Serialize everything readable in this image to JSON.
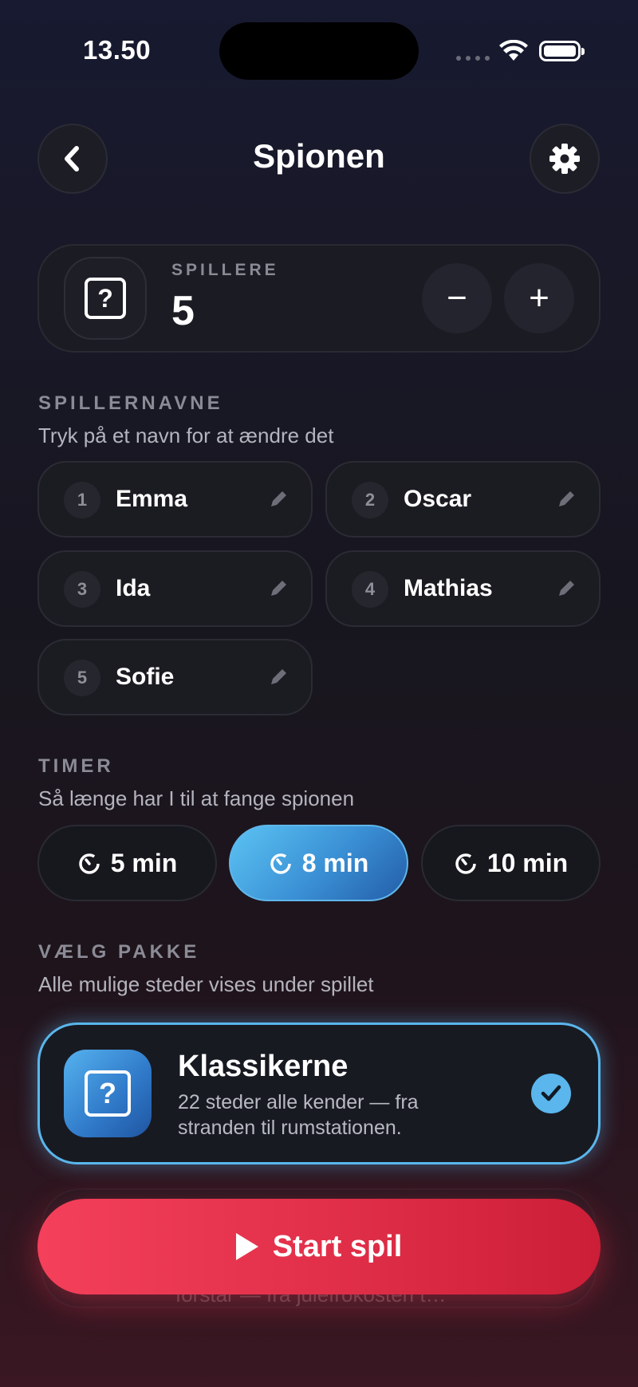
{
  "status_bar": {
    "time": "13.50"
  },
  "header": {
    "title": "Spionen"
  },
  "players": {
    "label": "SPILLERE",
    "count": "5",
    "minus": "−",
    "plus": "+"
  },
  "names_section": {
    "label": "SPILLERNAVNE",
    "subtitle": "Tryk på et navn for at ændre det",
    "players": [
      {
        "num": "1",
        "name": "Emma"
      },
      {
        "num": "2",
        "name": "Oscar"
      },
      {
        "num": "3",
        "name": "Ida"
      },
      {
        "num": "4",
        "name": "Mathias"
      },
      {
        "num": "5",
        "name": "Sofie"
      }
    ]
  },
  "timer_section": {
    "label": "TIMER",
    "subtitle": "Så længe har I til at fange spionen",
    "options": [
      "5 min",
      "8 min",
      "10 min"
    ],
    "selected": "8 min"
  },
  "pack_section": {
    "label": "VÆLG PAKKE",
    "subtitle": "Alle mulige steder vises under spillet",
    "selected_pack": {
      "title": "Klassikerne",
      "description": "22 steder alle kender — fra stranden til rumstationen."
    },
    "hidden_pack_text": "forstår — fra julefrokosten t…"
  },
  "start_button": {
    "label": "Start spil"
  },
  "colors": {
    "accent_blue": "#5ab6ec",
    "start_red": "#e2304a"
  },
  "icons": [
    "chevron-left-icon",
    "gear-icon",
    "question-box-icon",
    "pencil-icon",
    "timer-icon",
    "check-icon",
    "play-icon",
    "wifi-icon",
    "battery-icon"
  ]
}
